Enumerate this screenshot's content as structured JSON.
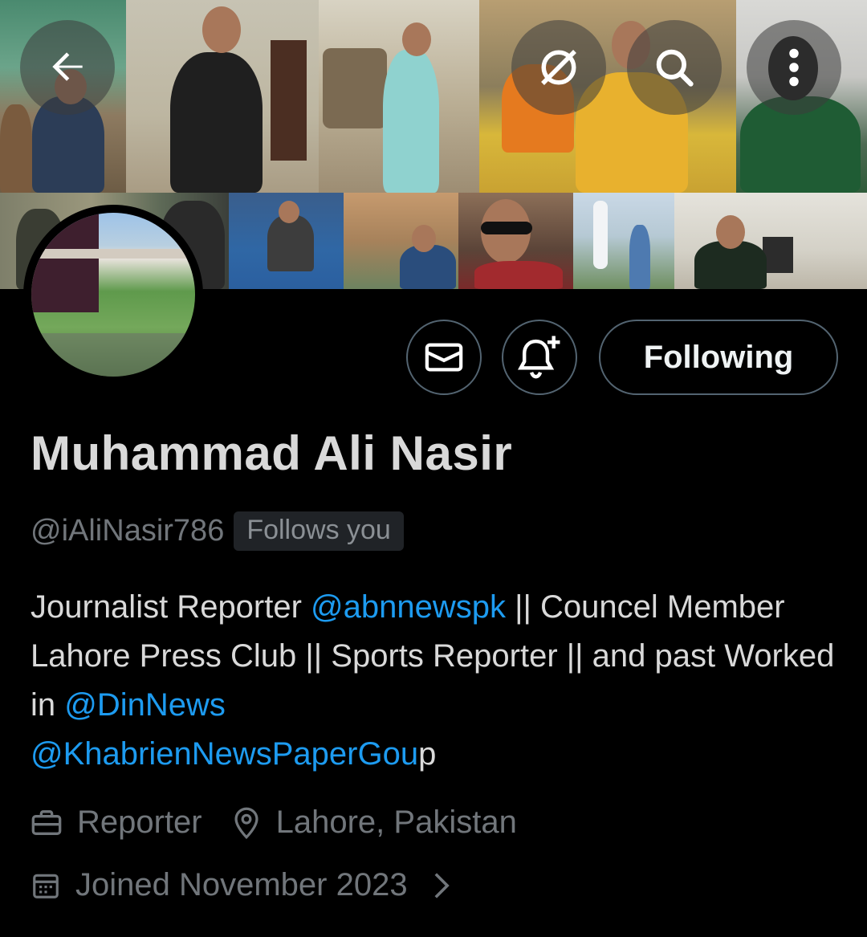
{
  "banner": {
    "icons": [
      "back-arrow-icon",
      "hide-eye-slash-icon",
      "search-icon",
      "more-vertical-icon"
    ]
  },
  "actions": {
    "message_icon": "envelope-icon",
    "notify_icon": "bell-plus-icon",
    "follow_label": "Following"
  },
  "profile": {
    "name": "Muhammad Ali Nasir",
    "handle": "@iAliNasir786",
    "follows_badge": "Follows you",
    "bio": {
      "t1": "Journalist Reporter ",
      "m1": "@abnnewspk",
      "t2": " || Councel Member Lahore Press Club || Sports Reporter  || and past Worked in ",
      "m2": "@DinNews",
      "t3": " ",
      "m3": "@KhabrienNewsPaperGou",
      "t4": "p"
    },
    "profession": "Reporter",
    "location": "Lahore, Pakistan",
    "joined": "Joined November 2023"
  },
  "colors": {
    "background": "#000000",
    "text": "#e7e9ea",
    "muted": "#71767b",
    "link": "#1d9bf0",
    "border": "#536471"
  }
}
